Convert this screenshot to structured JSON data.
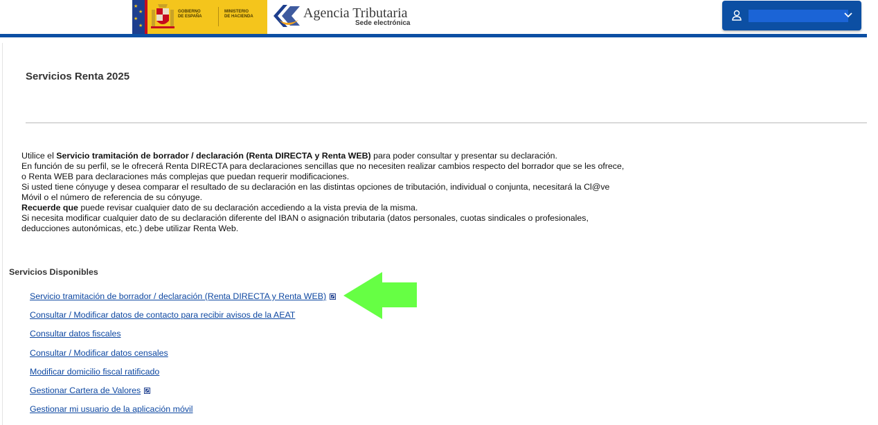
{
  "header": {
    "government_logo": {
      "gov_line1": "GOBIERNO",
      "gov_line2": "DE ESPAÑA",
      "ministry_line1": "MINISTERIO",
      "ministry_line2": "DE HACIENDA"
    },
    "agency_name": "Agencia Tributaria",
    "agency_subtitle": "Sede electrónica",
    "user_menu": {
      "icon": "user-icon",
      "name_redacted": true,
      "dropdown_icon": "chevron-down-icon"
    }
  },
  "page": {
    "title": "Servicios Renta 2025"
  },
  "intro": {
    "line1_pre": "Utilice el ",
    "line1_bold": "Servicio tramitación de borrador / declaración (Renta DIRECTA y Renta WEB)",
    "line1_post": " para poder consultar y presentar su declaración.",
    "line2": "En función de su perfil, se le ofrecerá Renta DIRECTA para declaraciones sencillas que no necesiten realizar cambios respecto del borrador que se les ofrece,",
    "line3": "o Renta WEB para declaraciones más complejas que puedan requerir modificaciones.",
    "line4": "Si usted tiene cónyuge y desea comparar el resultado de su declaración en las distintas opciones de tributación, individual o conjunta, necesitará la Cl@ve",
    "line5": "Móvil o el número de referencia de su cónyuge.",
    "line6_bold": "Recuerde que",
    "line6_post": " puede revisar cualquier dato de su declaración accediendo a la vista previa de la misma.",
    "line7": "Si necesita modificar cualquier dato de su declaración diferente del IBAN o asignación tributaria (datos personales, cuotas sindicales o profesionales,",
    "line8": "deducciones autonómicas, etc.) debe utilizar Renta Web."
  },
  "services": {
    "section_title": "Servicios Disponibles",
    "items": [
      {
        "label": "Servicio tramitación de borrador / declaración (Renta DIRECTA y Renta WEB)",
        "external": true
      },
      {
        "label": "Consultar / Modificar datos de contacto para recibir avisos de la AEAT",
        "external": false
      },
      {
        "label": "Consultar datos fiscales",
        "external": false
      },
      {
        "label": "Consultar / Modificar datos censales",
        "external": false
      },
      {
        "label": "Modificar domicilio fiscal ratificado",
        "external": false
      },
      {
        "label": "Gestionar Cartera de Valores",
        "external": true
      },
      {
        "label": "Gestionar mi usuario de la aplicación móvil",
        "external": false
      }
    ]
  },
  "annotation": {
    "icon": "green-arrow-left",
    "color": "#66ff44"
  },
  "colors": {
    "brand_blue": "#0c4fa3",
    "link_blue": "#0d47a1",
    "gov_yellow": "#f4c51c"
  }
}
